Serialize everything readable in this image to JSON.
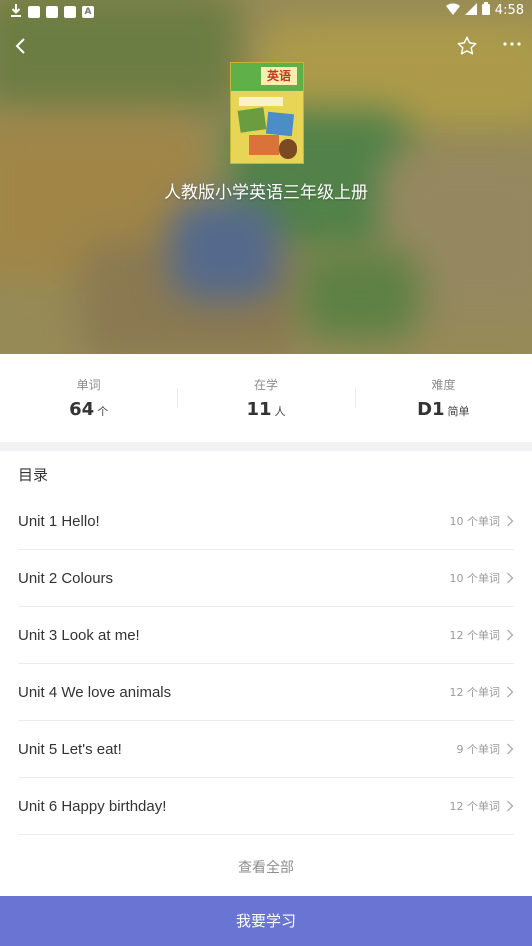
{
  "statusbar": {
    "time": "4:58"
  },
  "book": {
    "title": "人教版小学英语三年级上册",
    "cover_text": "英语"
  },
  "stats": [
    {
      "label": "单词",
      "value": "64",
      "unit": "个"
    },
    {
      "label": "在学",
      "value": "11",
      "unit": "人"
    },
    {
      "label": "难度",
      "value": "D1",
      "unit": "简单"
    }
  ],
  "catalog": {
    "heading": "目录",
    "units": [
      {
        "name": "Unit 1 Hello!",
        "count": "10 个单词"
      },
      {
        "name": "Unit 2 Colours",
        "count": "10 个单词"
      },
      {
        "name": "Unit 3 Look at me!",
        "count": "12 个单词"
      },
      {
        "name": "Unit 4 We love animals",
        "count": "12 个单词"
      },
      {
        "name": "Unit 5 Let's eat!",
        "count": "9 个单词"
      },
      {
        "name": "Unit 6 Happy birthday!",
        "count": "12 个单词"
      }
    ],
    "view_all": "查看全部"
  },
  "actions": {
    "learn": "我要学习"
  },
  "colors": {
    "accent": "#6a74d3",
    "hero_tint": "#b9ad6e"
  }
}
